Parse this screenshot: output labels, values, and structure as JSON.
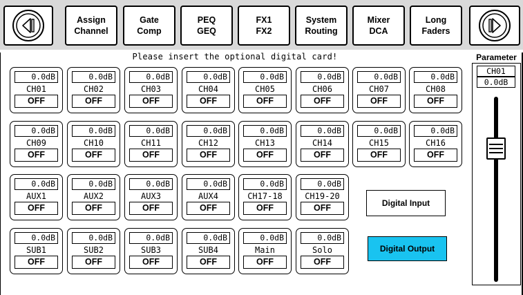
{
  "topbar": {
    "tabs": [
      {
        "line1": "Assign",
        "line2": "Channel"
      },
      {
        "line1": "Gate",
        "line2": "Comp"
      },
      {
        "line1": "PEQ",
        "line2": "GEQ"
      },
      {
        "line1": "FX1",
        "line2": "FX2"
      },
      {
        "line1": "System",
        "line2": "Routing"
      },
      {
        "line1": "Mixer",
        "line2": "DCA"
      },
      {
        "line1": "Long",
        "line2": "Faders"
      }
    ],
    "prev_icon": "rewind-circle-icon",
    "next_icon": "forward-circle-icon"
  },
  "notice": "Please insert the optional digital card!",
  "channels": {
    "rows": [
      [
        {
          "db": "0.0dB",
          "name": "CH01",
          "state": "OFF"
        },
        {
          "db": "0.0dB",
          "name": "CH02",
          "state": "OFF"
        },
        {
          "db": "0.0dB",
          "name": "CH03",
          "state": "OFF"
        },
        {
          "db": "0.0dB",
          "name": "CH04",
          "state": "OFF"
        },
        {
          "db": "0.0dB",
          "name": "CH05",
          "state": "OFF"
        },
        {
          "db": "0.0dB",
          "name": "CH06",
          "state": "OFF"
        },
        {
          "db": "0.0dB",
          "name": "CH07",
          "state": "OFF"
        },
        {
          "db": "0.0dB",
          "name": "CH08",
          "state": "OFF"
        }
      ],
      [
        {
          "db": "0.0dB",
          "name": "CH09",
          "state": "OFF"
        },
        {
          "db": "0.0dB",
          "name": "CH10",
          "state": "OFF"
        },
        {
          "db": "0.0dB",
          "name": "CH11",
          "state": "OFF"
        },
        {
          "db": "0.0dB",
          "name": "CH12",
          "state": "OFF"
        },
        {
          "db": "0.0dB",
          "name": "CH13",
          "state": "OFF"
        },
        {
          "db": "0.0dB",
          "name": "CH14",
          "state": "OFF"
        },
        {
          "db": "0.0dB",
          "name": "CH15",
          "state": "OFF"
        },
        {
          "db": "0.0dB",
          "name": "CH16",
          "state": "OFF"
        }
      ],
      [
        {
          "db": "0.0dB",
          "name": "AUX1",
          "state": "OFF"
        },
        {
          "db": "0.0dB",
          "name": "AUX2",
          "state": "OFF"
        },
        {
          "db": "0.0dB",
          "name": "AUX3",
          "state": "OFF"
        },
        {
          "db": "0.0dB",
          "name": "AUX4",
          "state": "OFF"
        },
        {
          "db": "0.0dB",
          "name": "CH17-18",
          "state": "OFF"
        },
        {
          "db": "0.0dB",
          "name": "CH19-20",
          "state": "OFF"
        }
      ],
      [
        {
          "db": "0.0dB",
          "name": "SUB1",
          "state": "OFF"
        },
        {
          "db": "0.0dB",
          "name": "SUB2",
          "state": "OFF"
        },
        {
          "db": "0.0dB",
          "name": "SUB3",
          "state": "OFF"
        },
        {
          "db": "0.0dB",
          "name": "SUB4",
          "state": "OFF"
        },
        {
          "db": "0.0dB",
          "name": "Main",
          "state": "OFF"
        },
        {
          "db": "0.0dB",
          "name": "Solo",
          "state": "OFF"
        }
      ]
    ]
  },
  "digital": {
    "input_label": "Digital Input",
    "output_label": "Digital Output",
    "output_color": "#19c3f0"
  },
  "parameter": {
    "title": "Parameter",
    "channel": "CH01",
    "value": "0.0dB"
  }
}
